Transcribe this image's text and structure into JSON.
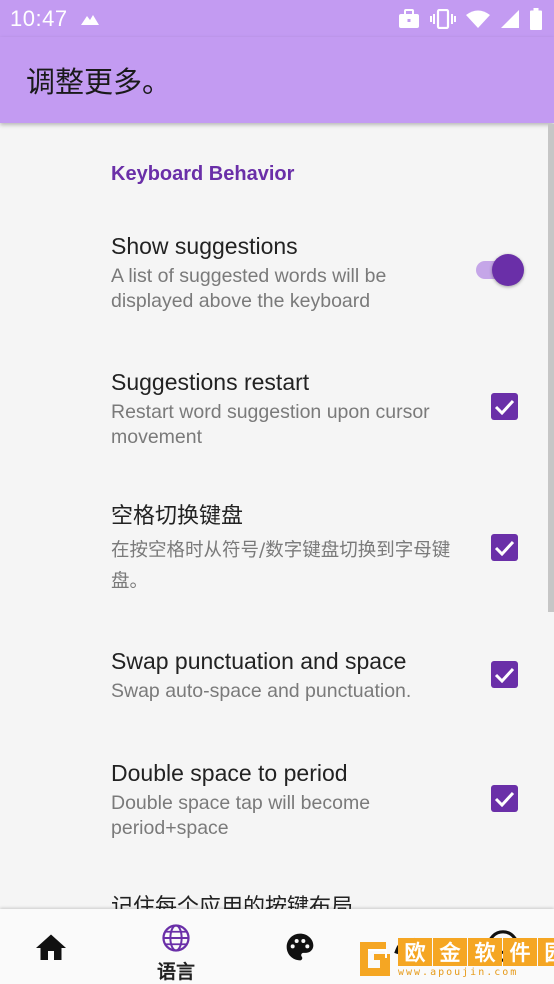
{
  "status_bar": {
    "time": "10:47",
    "icons": [
      "notification-triangle-icon",
      "work-briefcase-icon",
      "vibrate-icon",
      "wifi-icon",
      "signal-icon",
      "battery-icon"
    ]
  },
  "app_bar": {
    "title": "调整更多。"
  },
  "section": {
    "header": "Keyboard Behavior"
  },
  "items": [
    {
      "title": "Show suggestions",
      "summary": "A list of suggested words will be displayed above the keyboard",
      "control": "switch",
      "checked": true
    },
    {
      "title": "Suggestions restart",
      "summary": "Restart word suggestion upon cursor movement",
      "control": "checkbox",
      "checked": true
    },
    {
      "title": "空格切换键盘",
      "summary": "在按空格时从符号/数字键盘切换到字母键盘。",
      "control": "checkbox",
      "checked": true
    },
    {
      "title": "Swap punctuation and space",
      "summary": "Swap auto-space and punctuation.",
      "control": "checkbox",
      "checked": true
    },
    {
      "title": "Double space to period",
      "summary": "Double space tap will become period+space",
      "control": "checkbox",
      "checked": true
    },
    {
      "title": "记住每个应用的按键布局",
      "summary": "",
      "control": "none",
      "checked": false
    }
  ],
  "bottom_nav": {
    "items": [
      {
        "icon": "home-icon",
        "label": ""
      },
      {
        "icon": "globe-icon",
        "label": "语言",
        "selected": true
      },
      {
        "icon": "palette-icon",
        "label": ""
      },
      {
        "icon": "gesture-icon",
        "label": ""
      },
      {
        "icon": "emoji-icon",
        "label": ""
      }
    ]
  },
  "watermark": {
    "chars": [
      "欧",
      "金",
      "软",
      "件",
      "园"
    ],
    "url": "www.apoujin.com"
  },
  "colors": {
    "accent": "#6a2fa8",
    "app_bar": "#c39bf2",
    "background": "#f5f5f5"
  }
}
